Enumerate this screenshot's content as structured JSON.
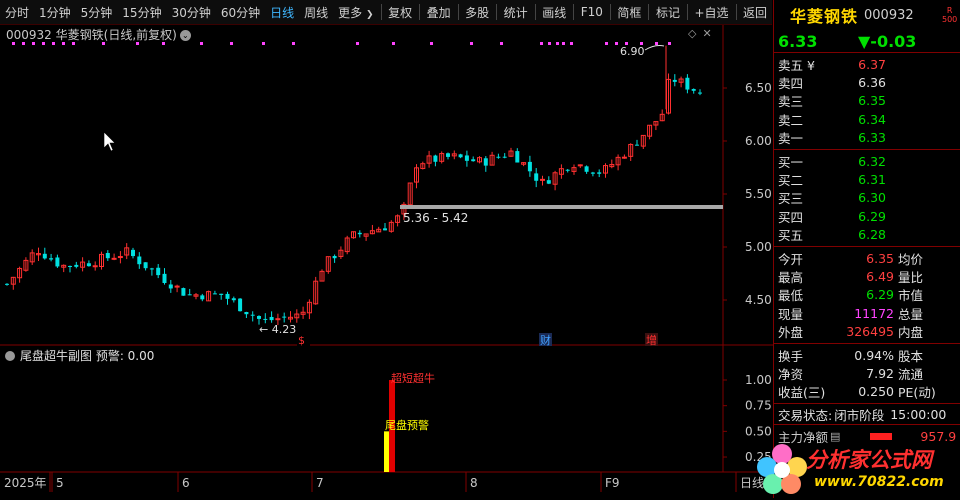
{
  "toolbar": {
    "periods": [
      "分时",
      "1分钟",
      "5分钟",
      "15分钟",
      "30分钟",
      "60分钟",
      "日线",
      "周线"
    ],
    "active": "日线",
    "more": "更多",
    "tools": [
      "复权",
      "叠加",
      "多股",
      "统计",
      "画线",
      "F10",
      "简框",
      "标记",
      "+自选",
      "返回"
    ]
  },
  "chart": {
    "title_code": "000932",
    "title_name": "华菱钢铁",
    "title_mode": "(日线,前复权)",
    "price_axis": [
      "6.50",
      "6.00",
      "5.50",
      "5.00",
      "4.50"
    ],
    "label_high": "6.90",
    "label_low": "4.23",
    "label_range": "5.36 - 5.42",
    "markers": [
      "$",
      "财",
      "增"
    ]
  },
  "subchart": {
    "title": "尾盘超牛副图",
    "warn_label": "预警:",
    "warn_value": "0.00",
    "axis": [
      "1.00",
      "0.75",
      "0.50",
      "0.25"
    ],
    "label_bull": "超短超牛",
    "label_warn": "尾盘预警"
  },
  "date_axis": [
    "2025年",
    "5",
    "6",
    "7",
    "8",
    "F9",
    "日线"
  ],
  "quote": {
    "name": "华菱钢铁",
    "code": "000932",
    "badge_top": "R",
    "badge_bottom": "500",
    "price": "6.33",
    "change": "▼-0.03",
    "sell": [
      {
        "label": "卖五 ¥",
        "price": "6.37",
        "color": "r"
      },
      {
        "label": "卖四",
        "price": "6.36",
        "color": "w"
      },
      {
        "label": "卖三",
        "price": "6.35",
        "color": "g"
      },
      {
        "label": "卖二",
        "price": "6.34",
        "color": "g"
      },
      {
        "label": "卖一",
        "price": "6.33",
        "color": "g"
      }
    ],
    "buy": [
      {
        "label": "买一",
        "price": "6.32",
        "color": "g"
      },
      {
        "label": "买二",
        "price": "6.31",
        "color": "g"
      },
      {
        "label": "买三",
        "price": "6.30",
        "color": "g"
      },
      {
        "label": "买四",
        "price": "6.29",
        "color": "g"
      },
      {
        "label": "买五",
        "price": "6.28",
        "color": "g"
      }
    ],
    "stats": [
      {
        "l1": "今开",
        "v1": "6.35",
        "c1": "r",
        "l2": "均价"
      },
      {
        "l1": "最高",
        "v1": "6.49",
        "c1": "r",
        "l2": "量比"
      },
      {
        "l1": "最低",
        "v1": "6.29",
        "c1": "g",
        "l2": "市值"
      },
      {
        "l1": "现量",
        "v1": "11172",
        "c1": "m",
        "l2": "总量"
      },
      {
        "l1": "外盘",
        "v1": "326495",
        "c1": "r",
        "l2": "内盘"
      }
    ],
    "stats2": [
      {
        "l1": "换手",
        "v1": "0.94%",
        "l2": "股本"
      },
      {
        "l1": "净资",
        "v1": "7.92",
        "l2": "流通"
      },
      {
        "l1": "收益(三)",
        "v1": "0.250",
        "l2": "PE(动)"
      }
    ],
    "status_label": "交易状态:",
    "status_value": "闭市阶段",
    "status_time": "15:00:00",
    "netflow_label": "主力净额",
    "netflow_value": "957.9"
  },
  "logo": {
    "text": "分析家公式网",
    "url": "www.70822.com"
  },
  "colors": {
    "up": "#ff3030",
    "down": "#00e0e0",
    "magenta": "#ff44ff",
    "gold": "#ffd700"
  }
}
